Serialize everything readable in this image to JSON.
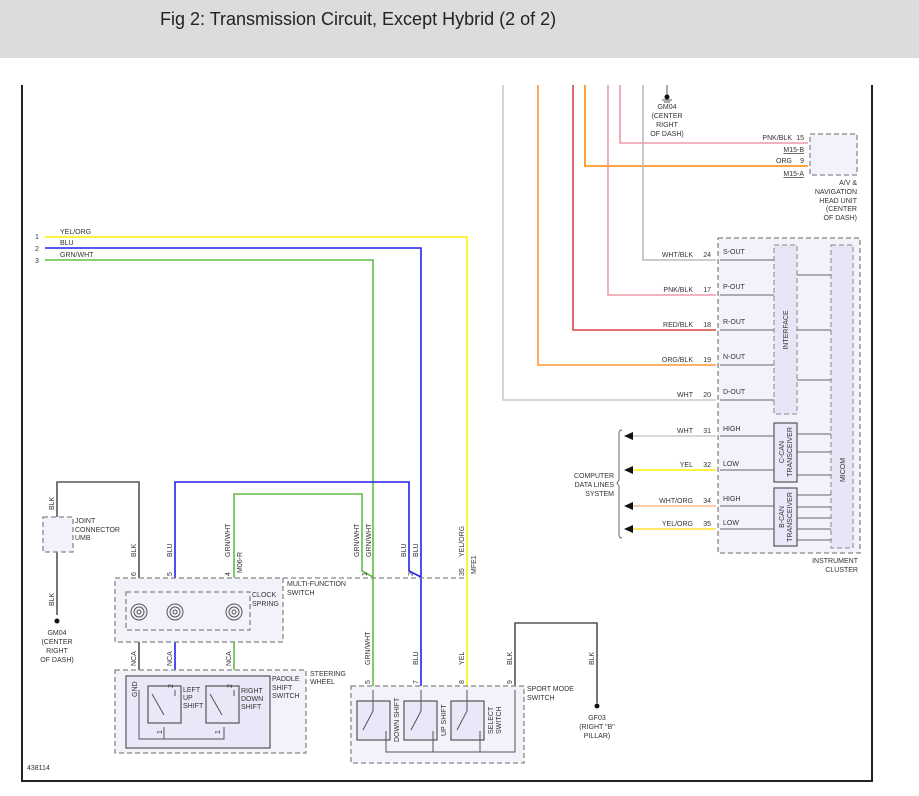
{
  "header": {
    "title": "Fig 2: Transmission Circuit, Except Hybrid (2 of 2)"
  },
  "colors": {
    "yel": "#ffee00",
    "blu": "#2222ee",
    "grn": "#66bb44",
    "blk": "#555555",
    "wht": "#bbbbbb",
    "org": "#ff8800",
    "red": "#dd3333",
    "pnk": "#ee8899",
    "yelorg": "#ffdd33",
    "whtorg": "#ffbb88"
  },
  "left_wires": [
    {
      "pin": "1",
      "label": "YEL/ORG"
    },
    {
      "pin": "2",
      "label": "BLU"
    },
    {
      "pin": "3",
      "label": "GRN/WHT"
    }
  ],
  "ground_top": {
    "name": "GM04",
    "loc1": "(CENTER",
    "loc2": "RIGHT",
    "loc3": "OF DASH)"
  },
  "head_unit": {
    "wires": [
      {
        "label": "PNK/BLK",
        "pin": "15",
        "conn": "M15-B"
      },
      {
        "label": "ORG",
        "pin": "9",
        "conn": "M15-A"
      }
    ],
    "name1": "A/V &",
    "name2": "NAVIGATION",
    "name3": "HEAD UNIT",
    "name4": "(CENTER",
    "name5": "OF DASH)"
  },
  "cluster": {
    "outputs": [
      {
        "wire": "WHT/BLK",
        "pin": "24",
        "sig": "S-OUT"
      },
      {
        "wire": "PNK/BLK",
        "pin": "17",
        "sig": "P-OUT"
      },
      {
        "wire": "RED/BLK",
        "pin": "18",
        "sig": "R-OUT"
      },
      {
        "wire": "ORG/BLK",
        "pin": "19",
        "sig": "N-OUT"
      },
      {
        "wire": "WHT",
        "pin": "20",
        "sig": "D-OUT"
      }
    ],
    "can": [
      {
        "wire": "WHT",
        "pin": "31",
        "sig": "HIGH"
      },
      {
        "wire": "YEL",
        "pin": "32",
        "sig": "LOW"
      },
      {
        "wire": "WHT/ORG",
        "pin": "34",
        "sig": "HIGH"
      },
      {
        "wire": "YEL/ORG",
        "pin": "35",
        "sig": "LOW"
      }
    ],
    "interface": "INTERFACE",
    "micom": "MICOM",
    "ccan1": "C-CAN",
    "ccan2": "TRANSCEIVER",
    "bcan1": "B-CAN",
    "bcan2": "TRANSCEIVER",
    "name1": "INSTRUMENT",
    "name2": "CLUSTER",
    "data_lines1": "COMPUTER",
    "data_lines2": "DATA LINES",
    "data_lines3": "SYSTEM"
  },
  "joint": {
    "wire_top": "BLK",
    "wire_bottom": "BLK",
    "name1": "JOINT",
    "name2": "CONNECTOR",
    "name3": "UMB"
  },
  "ground_left": {
    "name": "GM04",
    "loc1": "(CENTER",
    "loc2": "RIGHT",
    "loc3": "OF DASH)"
  },
  "mfs": {
    "pins": [
      {
        "pin": "6",
        "wire": "BLK"
      },
      {
        "pin": "5",
        "wire": "BLU"
      },
      {
        "pin": "4",
        "wire": "GRN/WHT"
      }
    ],
    "conn": "M06-R",
    "name1": "MULTI-FUNCTION",
    "name2": "SWITCH",
    "cs1": "CLOCK",
    "cs2": "SPRING",
    "nca": "NCA",
    "right_pins": [
      {
        "pin": "1",
        "wire": "GRN/WHT"
      },
      {
        "pin": "2",
        "wire": "BLU"
      },
      {
        "pin": "35",
        "wire": "YEL/ORG"
      }
    ],
    "right_conn": "MFE1"
  },
  "paddle": {
    "gnd": "GND",
    "pin2": "2",
    "pin1": "1",
    "left1": "LEFT",
    "left2": "UP",
    "left3": "SHIFT",
    "right1": "RIGHT",
    "right2": "DOWN",
    "right3": "SHIFT",
    "name1": "PADDLE",
    "name2": "SHIFT",
    "name3": "SWITCH",
    "sw1": "STEERING",
    "sw2": "WHEEL"
  },
  "sport": {
    "pins": [
      {
        "pin": "5",
        "wire": "GRN/WHT"
      },
      {
        "pin": "7",
        "wire": "BLU"
      },
      {
        "pin": "8",
        "wire": "YEL"
      },
      {
        "pin": "9",
        "wire": "BLK"
      }
    ],
    "down": "DOWN SHIFT",
    "up": "UP SHIFT",
    "sel1": "SELECT",
    "sel2": "SWITCH",
    "name1": "SPORT MODE",
    "name2": "SWITCH",
    "gnd_wire": "BLK"
  },
  "ground_right": {
    "name": "GF03",
    "loc1": "(RIGHT \"B\"",
    "loc2": "PILLAR)"
  },
  "figure_id": "438114"
}
